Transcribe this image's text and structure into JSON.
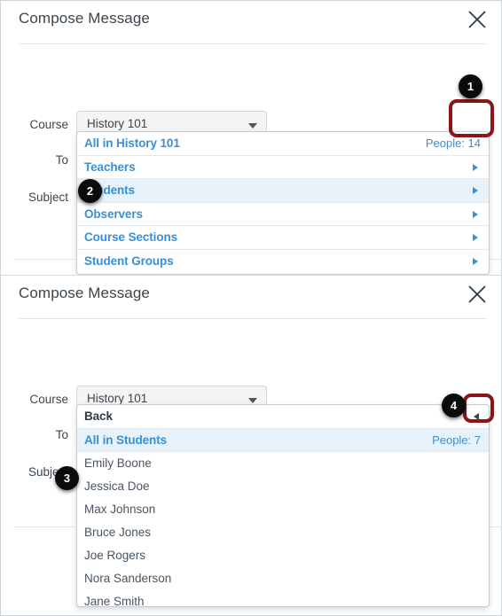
{
  "panel1": {
    "title": "Compose Message",
    "close_icon": "close-icon",
    "course_label": "Course",
    "course_value": "History 101",
    "to_label": "To",
    "to_value": "",
    "subject_label": "Subject",
    "address_book_icon": "address-book-icon",
    "menu": [
      {
        "label": "All in History 101",
        "meta": "People: 14",
        "submenu": false,
        "selected": false
      },
      {
        "label": "Teachers",
        "meta": "",
        "submenu": true,
        "selected": false
      },
      {
        "label": "Students",
        "meta": "",
        "submenu": true,
        "selected": true
      },
      {
        "label": "Observers",
        "meta": "",
        "submenu": true,
        "selected": false
      },
      {
        "label": "Course Sections",
        "meta": "",
        "submenu": true,
        "selected": false
      },
      {
        "label": "Student Groups",
        "meta": "",
        "submenu": true,
        "selected": false
      }
    ]
  },
  "panel2": {
    "title": "Compose Message",
    "close_icon": "close-icon",
    "course_label": "Course",
    "course_value": "History 101",
    "to_label": "To",
    "to_value": "",
    "subject_label": "Subject",
    "address_book_icon": "address-book-icon",
    "back_label": "Back",
    "all_label": "All in Students",
    "all_meta": "People: 7",
    "people": [
      "Emily Boone",
      "Jessica Doe",
      "Max Johnson",
      "Bruce Jones",
      "Joe Rogers",
      "Nora Sanderson",
      "Jane Smith"
    ]
  },
  "annotations": {
    "badge1": "1",
    "badge2": "2",
    "badge3": "3",
    "badge4": "4"
  },
  "colors": {
    "link": "#3b8fd4",
    "highlight": "#e7f2fa",
    "focus_border": "#68b5e8",
    "annotation": "#8c1515"
  }
}
